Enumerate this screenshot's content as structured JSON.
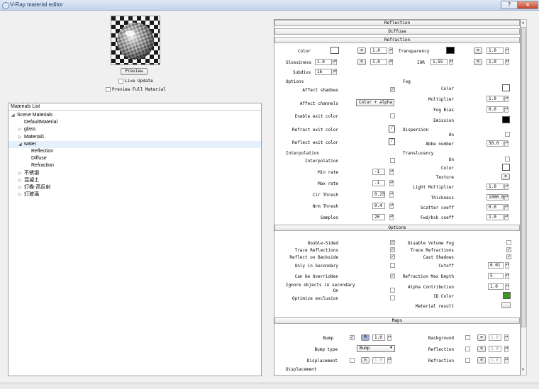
{
  "window": {
    "title": "V-Ray material editor",
    "help": "?",
    "close": "×"
  },
  "preview": {
    "button": "Preview",
    "live_update": "Live Update",
    "live_update_checked": false,
    "full_material": "Preview Full Material",
    "full_material_checked": false
  },
  "materials": {
    "header": "Materials List",
    "items": [
      {
        "label": "Scene Materials",
        "depth": 0,
        "arrow": "◢"
      },
      {
        "label": "DefaultMaterial",
        "depth": 1,
        "arrow": ""
      },
      {
        "label": "glass",
        "depth": 1,
        "arrow": "▷"
      },
      {
        "label": "Material1",
        "depth": 1,
        "arrow": "▷"
      },
      {
        "label": "water",
        "depth": 1,
        "arrow": "◢",
        "selected": true
      },
      {
        "label": "Reflection",
        "depth": 2,
        "arrow": ""
      },
      {
        "label": "Diffuse",
        "depth": 2,
        "arrow": ""
      },
      {
        "label": "Refraction",
        "depth": 2,
        "arrow": ""
      },
      {
        "label": "不锈钢",
        "depth": 1,
        "arrow": "▷"
      },
      {
        "label": "混凝土",
        "depth": 1,
        "arrow": "▷"
      },
      {
        "label": "灯檐-高反射",
        "depth": 1,
        "arrow": "▷"
      },
      {
        "label": "灯玻璃",
        "depth": 1,
        "arrow": "▷"
      }
    ]
  },
  "sections": {
    "reflection": "Reflection",
    "diffuse": "Diffuse",
    "refraction": "Refraction",
    "options": "Options",
    "maps": "Maps"
  },
  "refraction": {
    "color_label": "Color",
    "color": "#ffffff",
    "color_m": "m",
    "color_val": "1.0",
    "transparency_label": "Transparency",
    "transparency": "#000000",
    "transparency_m": "m",
    "transparency_val": "1.0",
    "glossiness_label": "Glossiness",
    "glossiness": "1.0",
    "glossiness_m": "m",
    "glossiness_val": "1.0",
    "ior_label": "IOR",
    "ior": "1.55",
    "ior_m": "m",
    "ior_val": "1.0",
    "subdivs_label": "Subdivs",
    "subdivs": "16",
    "options_title": "Options",
    "affect_shadows": "Affect shadows",
    "affect_shadows_checked": true,
    "affect_channels": "Affect channels",
    "affect_channels_value": "Color + alpha",
    "enable_exit": "Enable exit color",
    "enable_exit_checked": false,
    "refract_exit": "Refract exit color",
    "reflect_exit": "Reflect exit color",
    "fog_title": "Fog",
    "fog_color": "Color",
    "fog_color_swatch": "#ffffff",
    "fog_multiplier": "Multiplier",
    "fog_multiplier_val": "1.0",
    "fog_bias": "Fog Bias",
    "fog_bias_val": "0.0",
    "emission": "Emission",
    "emission_swatch": "#000000",
    "dispersion_title": "Dispersion",
    "disp_on": "On",
    "disp_on_checked": false,
    "abbe": "Abbe number",
    "abbe_val": "50.0",
    "interp_title": "Interpolation",
    "interp": "Interpolation",
    "interp_checked": false,
    "min_rate": "Min rate",
    "min_rate_val": "-1",
    "max_rate": "Max rate",
    "max_rate_val": "-1",
    "clr_thresh": "Clr Thresh",
    "clr_thresh_val": "0.25",
    "nrm_thresh": "Nrm Thresh",
    "nrm_thresh_val": "0.4",
    "samples": "Samples",
    "samples_val": "20",
    "transl_title": "Translucency",
    "transl_on": "On",
    "transl_on_checked": false,
    "transl_color": "Color",
    "transl_color_swatch": "#ffffff",
    "texture": "Texture",
    "texture_m": "m",
    "light_mult": "Light Multiplier",
    "light_mult_val": "1.0",
    "thickness": "Thickness",
    "thickness_val": "1000.0",
    "scatter": "Scatter coeff",
    "scatter_val": "0.0",
    "fwdbck": "Fwd/bck coeff",
    "fwdbck_val": "1.0"
  },
  "options": {
    "double_sided": "Double-Sided",
    "double_sided_checked": true,
    "trace_refl": "Trace Reflections",
    "trace_refl_checked": true,
    "reflect_back": "Reflect on Backside",
    "reflect_back_checked": true,
    "only_secondary": "Only in Secondary",
    "only_secondary_checked": false,
    "can_override": "Can be Overridden",
    "can_override_checked": true,
    "ignore_title": "Ignore objects in secondary",
    "ignore_on": "On",
    "ignore_on_checked": false,
    "optimize": "Optimize exclusion",
    "optimize_checked": false,
    "disable_vol_fog": "Disable Volume Fog",
    "disable_vol_fog_checked": false,
    "trace_refr": "Trace Refractions",
    "trace_refr_checked": true,
    "cast_shadows": "Cast Shadows",
    "cast_shadows_checked": true,
    "cutoff": "Cutoff",
    "cutoff_val": "0.01",
    "refr_max_depth": "Refraction Max Depth",
    "refr_max_depth_val": "5",
    "alpha_contrib": "Alpha Contribution",
    "alpha_contrib_val": "1.0",
    "id_color": "ID Color",
    "id_color_swatch": "#3c9a1e",
    "mat_result": "Material result"
  },
  "maps": {
    "bump": "Bump",
    "bump_checked": true,
    "bump_m": "M",
    "bump_val": "1.0",
    "bump_type": "Bump type",
    "bump_type_value": "Bump",
    "displacement": "Displacement",
    "disp_checked": false,
    "disp_m": "m",
    "disp_val": "1.0",
    "background": "Background",
    "background_checked": false,
    "background_m": "m",
    "background_val": "1.0",
    "reflection": "Reflection",
    "reflection_checked": false,
    "reflection_m": "m",
    "reflection_val": "1.0",
    "refraction": "Refraction",
    "refraction_checked": false,
    "refraction_m": "m",
    "refraction_val": "1.0",
    "displacement_title": "Displacement"
  }
}
